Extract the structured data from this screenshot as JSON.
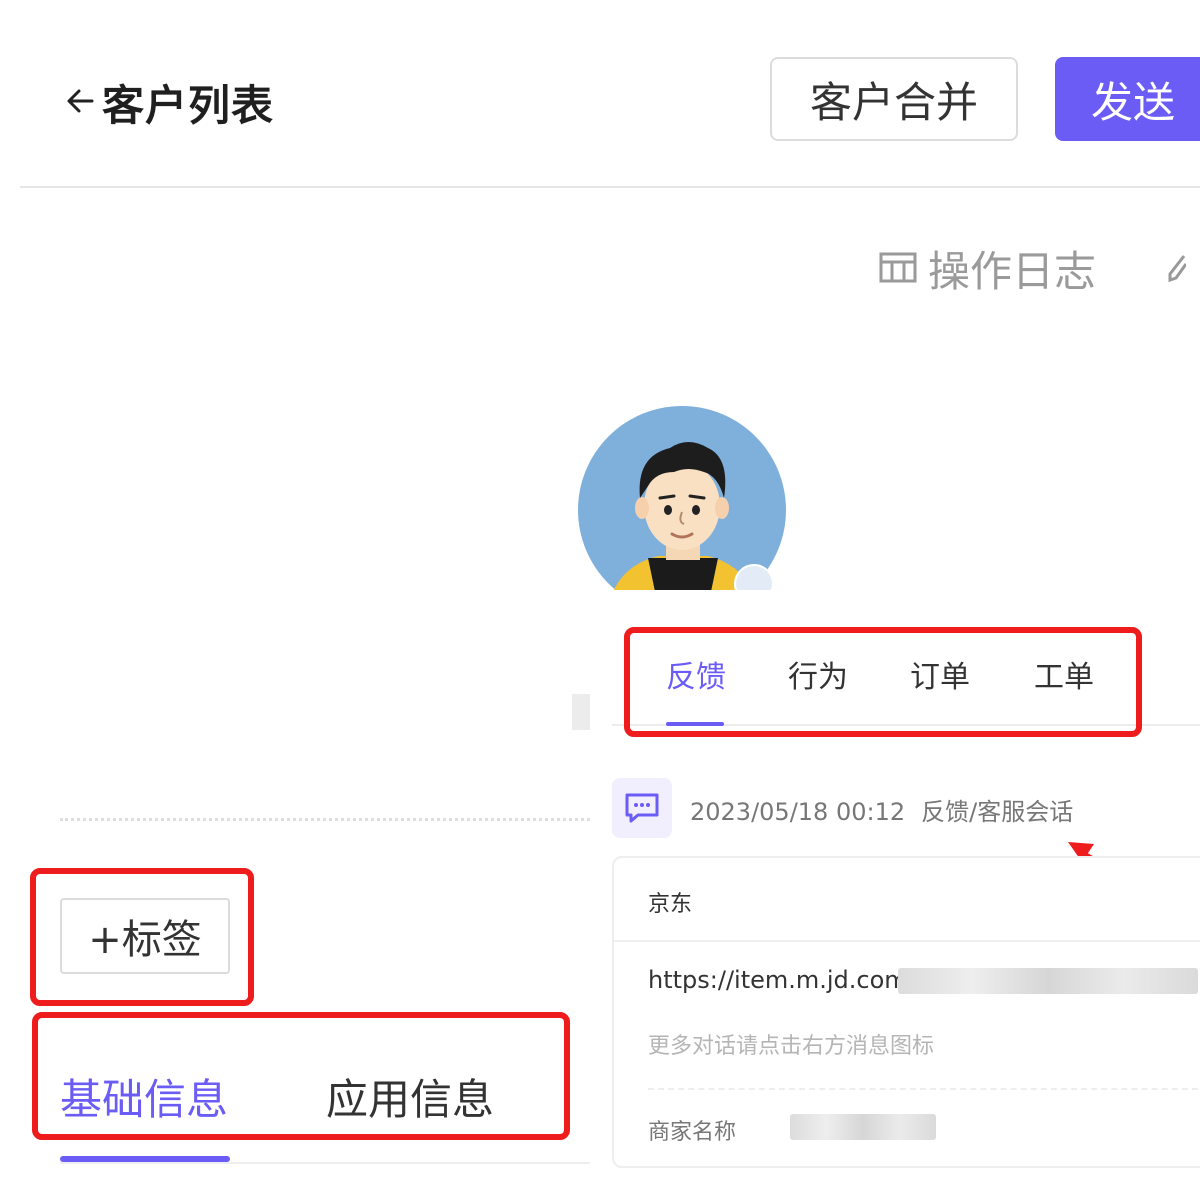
{
  "header": {
    "back_icon": "arrow-left-icon",
    "title": "客户列表",
    "merge_label": "客户合并",
    "send_label": "发送"
  },
  "op_log": {
    "icon": "calendar-icon",
    "label": "操作日志"
  },
  "profile": {
    "avatar": "cartoon-man-avatar",
    "avatar_bg": "#7fb0dc"
  },
  "tabs": [
    {
      "label": "反馈",
      "active": true
    },
    {
      "label": "行为",
      "active": false
    },
    {
      "label": "订单",
      "active": false
    },
    {
      "label": "工单",
      "active": false
    }
  ],
  "feedback": {
    "icon": "chat-bubble-icon",
    "datetime": "2023/05/18 00:12",
    "type": "反馈/客服会话",
    "store": "京东",
    "url": "https://item.m.jd.com",
    "hint": "更多对话请点击右方消息图标",
    "merchant_label": "商家名称"
  },
  "left_panel": {
    "tag_button_label": "+标签",
    "tabs": [
      {
        "label": "基础信息",
        "active": true
      },
      {
        "label": "应用信息",
        "active": false
      }
    ]
  },
  "colors": {
    "accent": "#6b5cf6",
    "annotation_red": "#ee1c1c"
  }
}
